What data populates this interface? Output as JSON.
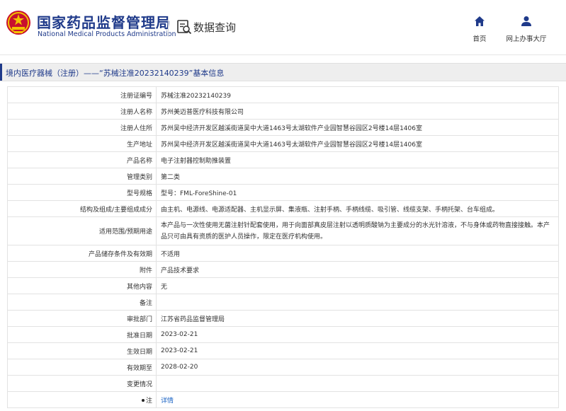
{
  "header": {
    "brand_cn": "国家药品监督管理局",
    "brand_en": "National Medical Products Administration",
    "query_title": "数据查询",
    "nav": [
      {
        "icon": "home-icon",
        "label": "首页"
      },
      {
        "icon": "user-icon",
        "label": "网上办事大厅"
      }
    ]
  },
  "colors": {
    "brand": "#1f3a8a",
    "link": "#1a63c4",
    "emblem_red": "#c8102e",
    "emblem_gold": "#f2c200"
  },
  "titlebar": {
    "text": "境内医疗器械（注册）——“苏械注准20232140239”基本信息"
  },
  "rows": [
    {
      "label": "注册证编号",
      "value": "苏械注准20232140239"
    },
    {
      "label": "注册人名称",
      "value": "苏州美迈普医疗科技有限公司"
    },
    {
      "label": "注册人住所",
      "value": "苏州吴中经济开发区越溪街道吴中大道1463号太湖软件产业园智慧谷园区2号楼14层1406室"
    },
    {
      "label": "生产地址",
      "value": "苏州吴中经济开发区越溪街道吴中大道1463号太湖软件产业园智慧谷园区2号楼14层1406室"
    },
    {
      "label": "产品名称",
      "value": "电子注射器控制助推装置"
    },
    {
      "label": "管理类别",
      "value": "第二类"
    },
    {
      "label": "型号规格",
      "value": "型号：FML-ForeShine-01"
    },
    {
      "label": "结构及组成/主要组成成分",
      "value": "由主机、电源线、电源适配器、主机显示屏、集液瓶、注射手柄、手柄线缆、吸引管、线缆支架、手柄托架、台车组成。"
    },
    {
      "label": "适用范围/预期用途",
      "value": "本产品与一次性使用无菌注射针配套使用，用于向面部真皮层注射以透明质酸钠为主要成分的水光针溶液，不与身体或药物直接接触。本产品只可由具有资质的医护人员操作，限定在医疗机构使用。"
    },
    {
      "label": "产品储存条件及有效期",
      "value": "不适用"
    },
    {
      "label": "附件",
      "value": "产品技术要求"
    },
    {
      "label": "其他内容",
      "value": "无"
    },
    {
      "label": "备注",
      "value": ""
    },
    {
      "label": "审批部门",
      "value": "江苏省药品监督管理局"
    },
    {
      "label": "批准日期",
      "value": "2023-02-21"
    },
    {
      "label": "生效日期",
      "value": "2023-02-21"
    },
    {
      "label": "有效期至",
      "value": "2028-02-20"
    },
    {
      "label": "变更情况",
      "value": ""
    },
    {
      "label": "注",
      "value": "详情"
    }
  ]
}
